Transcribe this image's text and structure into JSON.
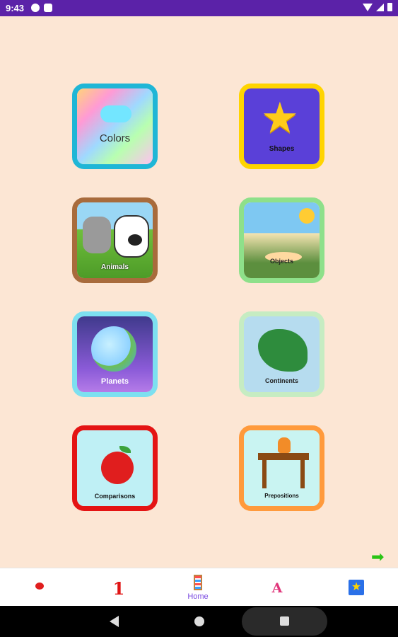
{
  "status_bar": {
    "time": "9:43",
    "left_icons": [
      "notification-icon",
      "sim-icon"
    ],
    "right_icons": [
      "wifi-icon",
      "signal-icon",
      "battery-icon"
    ]
  },
  "tiles": [
    {
      "label": "Colors",
      "icon": "rainbow-cloud",
      "border_color": "#1fb6d6"
    },
    {
      "label": "Shapes",
      "icon": "star-face",
      "border_color": "#ffd400"
    },
    {
      "label": "Animals",
      "icon": "farm-animals",
      "border_color": "#a86b3c"
    },
    {
      "label": "Objects",
      "icon": "playroom",
      "border_color": "#8ee08a"
    },
    {
      "label": "Planets",
      "icon": "earth-face",
      "border_color": "#7de0f0"
    },
    {
      "label": "Continents",
      "icon": "north-america-map",
      "border_color": "#c6ecc2"
    },
    {
      "label": "Comparisons",
      "icon": "apple-thumbs-up",
      "border_color": "#e41414"
    },
    {
      "label": "Prepositions",
      "icon": "cat-on-table",
      "border_color": "#ff9a3c"
    }
  ],
  "next_button": {
    "icon": "green-arrow-right"
  },
  "bottom_nav": {
    "items": [
      {
        "icon": "ladybug-icon",
        "label": ""
      },
      {
        "icon": "number-one-icon",
        "label": "1"
      },
      {
        "icon": "abacus-icon",
        "label": "Home",
        "active": true
      },
      {
        "icon": "letter-a-icon",
        "label": "A"
      },
      {
        "icon": "star-icon",
        "label": "★"
      }
    ],
    "active_color": "#7a4ae0"
  },
  "system_nav": {
    "buttons": [
      "back",
      "home",
      "recents"
    ]
  }
}
